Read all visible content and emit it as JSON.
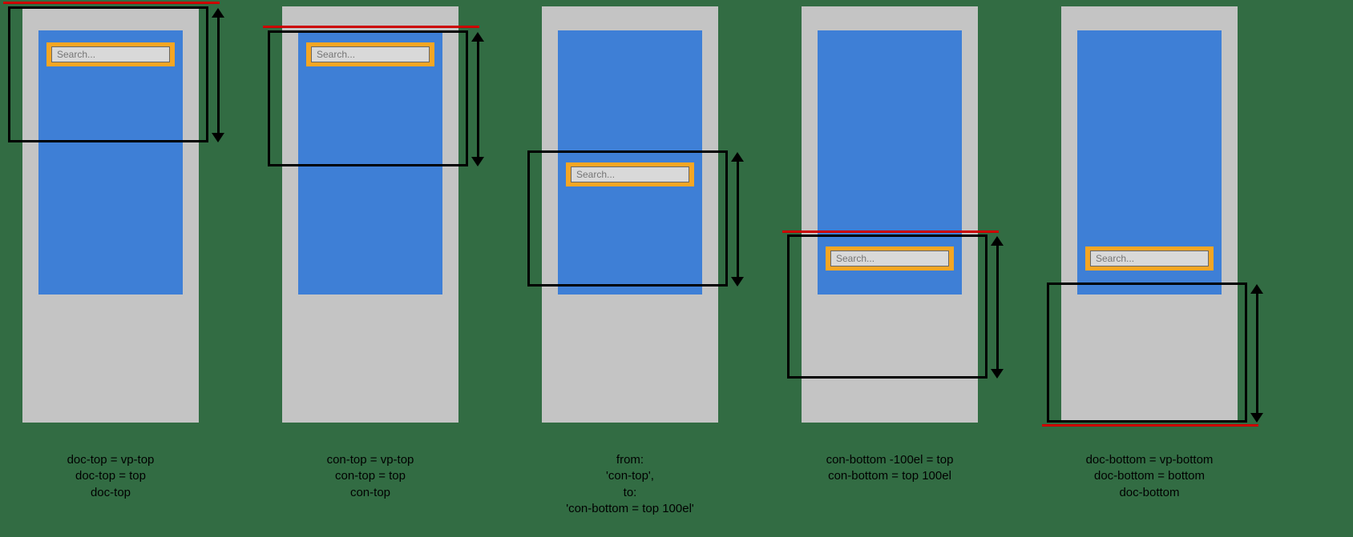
{
  "diagram": {
    "search_placeholder": "Search...",
    "panels": [
      {
        "id": "p1",
        "caption_l1": "doc-top = vp-top",
        "caption_l2": "doc-top = top",
        "caption_l3": "doc-top"
      },
      {
        "id": "p2",
        "caption_l1": "con-top = vp-top",
        "caption_l2": "con-top = top",
        "caption_l3": "con-top"
      },
      {
        "id": "p3",
        "caption_l1": "from:",
        "caption_l2": "'con-top',",
        "caption_l3": "to:",
        "caption_l4": "'con-bottom = top 100el'"
      },
      {
        "id": "p4",
        "caption_l1": "con-bottom -100el = top",
        "caption_l2": "con-bottom = top 100el"
      },
      {
        "id": "p5",
        "caption_l1": "doc-bottom = vp-bottom",
        "caption_l2": "doc-bottom = bottom",
        "caption_l3": "doc-bottom"
      }
    ]
  }
}
